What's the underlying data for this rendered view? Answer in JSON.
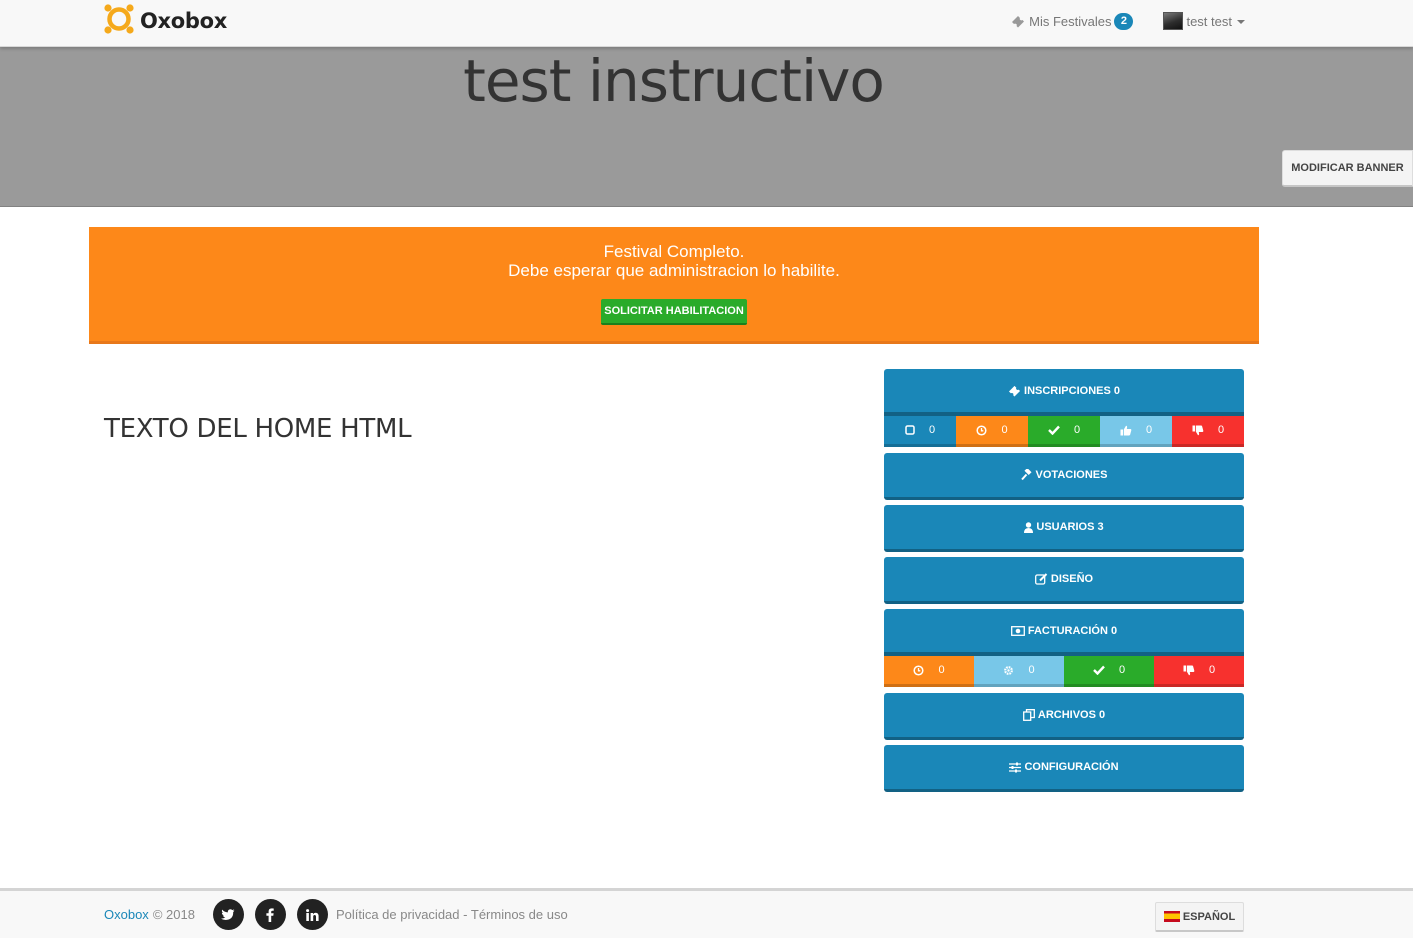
{
  "navbar": {
    "brand": "Oxobox",
    "festivals_label": "Mis Festivales",
    "festivals_count": "2",
    "user_name": "test test"
  },
  "banner": {
    "title": "test instructivo",
    "modify_label": "MODIFICAR BANNER"
  },
  "alert": {
    "line1": "Festival Completo.",
    "line2": "Debe esperar que administracion lo habilite.",
    "button_label": "SOLICITAR HABILITACION"
  },
  "home": {
    "text": "TEXTO DEL HOME HTML"
  },
  "panel": {
    "inscripciones": {
      "label": "INSCRIPCIONES 0",
      "stats": [
        {
          "icon": "square-icon",
          "value": "0",
          "color": "#1a87b8"
        },
        {
          "icon": "clock-icon",
          "value": "0",
          "color": "#fd8819"
        },
        {
          "icon": "check-icon",
          "value": "0",
          "color": "#2aab2a"
        },
        {
          "icon": "thumbs-up-icon",
          "value": "0",
          "color": "#78c7e8"
        },
        {
          "icon": "thumbs-down-icon",
          "value": "0",
          "color": "#f7312e"
        }
      ]
    },
    "votaciones": {
      "label": "VOTACIONES"
    },
    "usuarios": {
      "label": "USUARIOS 3"
    },
    "diseno": {
      "label": "DISEÑO"
    },
    "facturacion": {
      "label": "FACTURACIÓN 0",
      "stats": [
        {
          "icon": "clock-icon",
          "value": "0",
          "color": "#fd8819"
        },
        {
          "icon": "gear-icon",
          "value": "0",
          "color": "#78c7e8"
        },
        {
          "icon": "check-icon",
          "value": "0",
          "color": "#2aab2a"
        },
        {
          "icon": "thumbs-down-icon",
          "value": "0",
          "color": "#f7312e"
        }
      ]
    },
    "archivos": {
      "label": "ARCHIVOS 0"
    },
    "configuracion": {
      "label": "CONFIGURACIÓN"
    }
  },
  "footer": {
    "brand": "Oxobox",
    "copyright": "© 2018",
    "privacy": "Política de privacidad",
    "separator": "-",
    "terms": "Términos de uso",
    "language": "ESPAÑOL"
  },
  "colors": {
    "primary": "#1a87b8",
    "orange": "#fd8819",
    "green": "#2aab2a",
    "light_blue": "#78c7e8",
    "red": "#f7312e",
    "banner_gray": "#9a9a9a"
  }
}
